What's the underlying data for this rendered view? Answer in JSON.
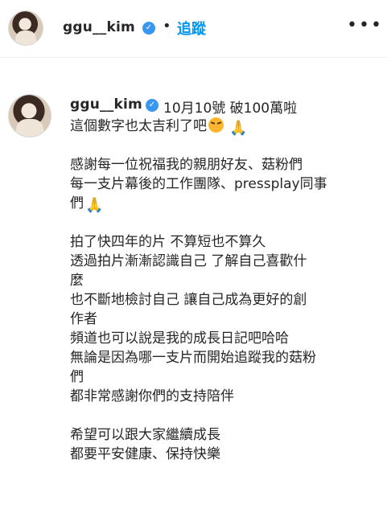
{
  "header": {
    "username": "ggu__kim",
    "separator": "•",
    "follow_label": "追蹤",
    "more_label": "•••"
  },
  "post": {
    "username": "ggu__kim",
    "date_text": "10月10號 破100萬啦",
    "lines": [
      "這個數字也太吉利了吧",
      "",
      "感謝每一位祝福我的親朋好友、菇粉們",
      "每一支片幕後的工作團隊、pressplay同事",
      "們",
      "",
      "拍了快四年的片 不算短也不算久",
      "透過拍片漸漸認識自己 了解自己喜歡什",
      "麼",
      "也不斷地檢討自己 讓自己成為更好的創",
      "作者",
      "頻道也可以說是我的成長日記吧哈哈",
      "無論是因為哪一支片而開始追蹤我的菇粉",
      "們",
      "都非常感謝你們的支持陪伴",
      "",
      "希望可以跟大家繼續成長",
      "都要平安健康、保持快樂"
    ]
  },
  "icons": {
    "verified": "verified-badge-icon",
    "face_emoji": "confounded-face-emoji",
    "hands_emoji": "folded-hands-emoji"
  },
  "colors": {
    "accent": "#0095f6",
    "verified": "#3897f0",
    "text": "#262626"
  }
}
